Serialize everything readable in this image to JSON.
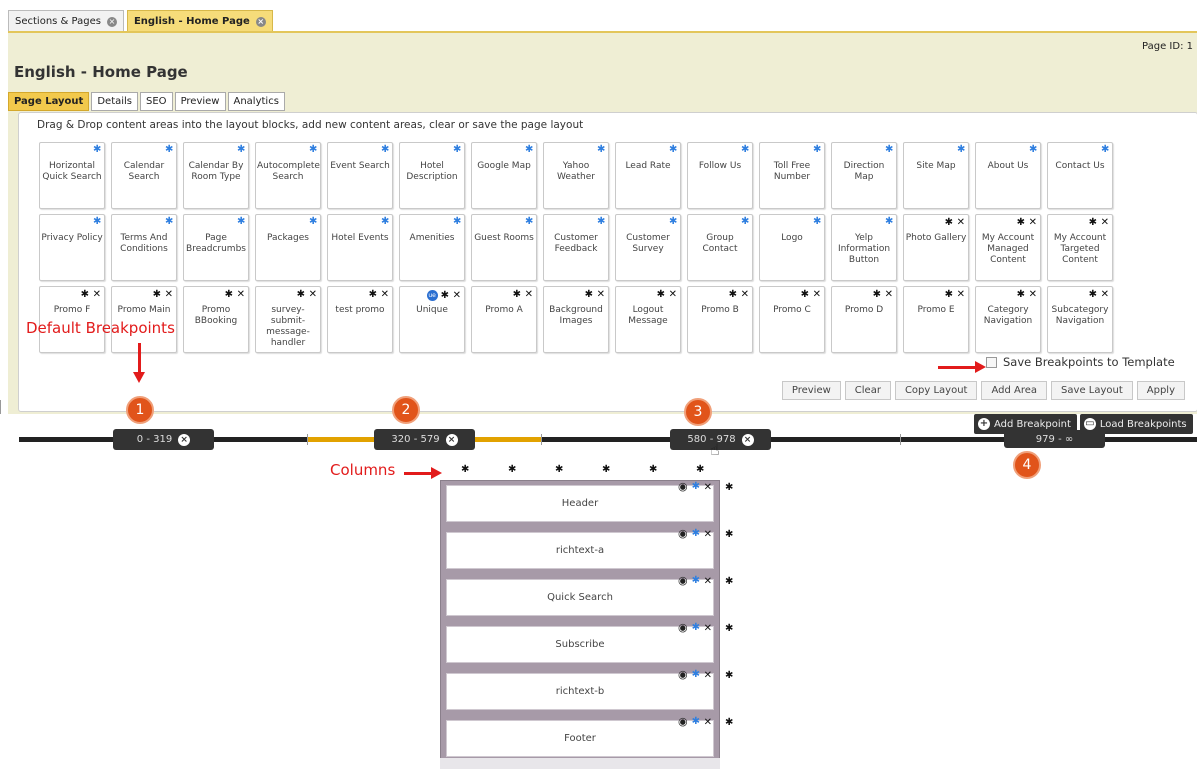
{
  "doc_tabs": [
    {
      "label": "Sections & Pages"
    },
    {
      "label": "English - Home Page"
    }
  ],
  "page_id_label": "Page ID: 1",
  "page_title": "English - Home Page",
  "sub_tabs": [
    "Page Layout",
    "Details",
    "SEO",
    "Preview",
    "Analytics"
  ],
  "instructions": "Drag & Drop content areas into the layout blocks, add new content areas, clear or save the page layout",
  "content_rows": [
    [
      {
        "label": "Horizontal Quick Search",
        "icons": "gear-blue"
      },
      {
        "label": "Calendar Search",
        "icons": "gear-blue"
      },
      {
        "label": "Calendar By Room Type",
        "icons": "gear-blue"
      },
      {
        "label": "Autocomplete Search",
        "icons": "gear-blue"
      },
      {
        "label": "Event Search",
        "icons": "gear-blue"
      },
      {
        "label": "Hotel Description",
        "icons": "gear-blue"
      },
      {
        "label": "Google Map",
        "icons": "gear-blue"
      },
      {
        "label": "Yahoo Weather",
        "icons": "gear-blue"
      },
      {
        "label": "Lead Rate",
        "icons": "gear-blue"
      },
      {
        "label": "Follow Us",
        "icons": "gear-blue"
      },
      {
        "label": "Toll Free Number",
        "icons": "gear-blue"
      },
      {
        "label": "Direction Map",
        "icons": "gear-blue"
      },
      {
        "label": "Site Map",
        "icons": "gear-blue"
      },
      {
        "label": "About Us",
        "icons": "gear-blue"
      },
      {
        "label": "Contact Us",
        "icons": "gear-blue"
      }
    ],
    [
      {
        "label": "Privacy Policy",
        "icons": "gear-blue"
      },
      {
        "label": "Terms And Conditions",
        "icons": "gear-blue"
      },
      {
        "label": "Page Breadcrumbs",
        "icons": "gear-blue"
      },
      {
        "label": "Packages",
        "icons": "gear-blue"
      },
      {
        "label": "Hotel Events",
        "icons": "gear-blue"
      },
      {
        "label": "Amenities",
        "icons": "gear-blue"
      },
      {
        "label": "Guest Rooms",
        "icons": "gear-blue"
      },
      {
        "label": "Customer Feedback",
        "icons": "gear-blue"
      },
      {
        "label": "Customer Survey",
        "icons": "gear-blue"
      },
      {
        "label": "Group Contact",
        "icons": "gear-blue"
      },
      {
        "label": "Logo",
        "icons": "gear-blue"
      },
      {
        "label": "Yelp Information Button",
        "icons": "gear-blue"
      },
      {
        "label": "Photo Gallery",
        "icons": "gear-x"
      },
      {
        "label": "My Account Managed Content",
        "icons": "gear-x"
      },
      {
        "label": "My Account Targeted Content",
        "icons": "gear-x"
      }
    ],
    [
      {
        "label": "Promo F",
        "icons": "gear-x"
      },
      {
        "label": "Promo Main",
        "icons": "gear-x"
      },
      {
        "label": "Promo BBooking",
        "icons": "gear-x"
      },
      {
        "label": "survey-submit-message-handler",
        "icons": "gear-x"
      },
      {
        "label": "test promo",
        "icons": "gear-x"
      },
      {
        "label": "Unique",
        "icons": "global-gear-x"
      },
      {
        "label": "Promo A",
        "icons": "gear-x"
      },
      {
        "label": "Background Images",
        "icons": "gear-x"
      },
      {
        "label": "Logout Message",
        "icons": "gear-x"
      },
      {
        "label": "Promo B",
        "icons": "gear-x"
      },
      {
        "label": "Promo C",
        "icons": "gear-x"
      },
      {
        "label": "Promo D",
        "icons": "gear-x"
      },
      {
        "label": "Promo E",
        "icons": "gear-x"
      },
      {
        "label": "Category Navigation",
        "icons": "gear-x"
      },
      {
        "label": "Subcategory Navigation",
        "icons": "gear-x"
      }
    ]
  ],
  "save_breakpoints_label": "Save Breakpoints to Template",
  "actions": [
    "Preview",
    "Clear",
    "Copy Layout",
    "Add Area",
    "Save Layout",
    "Apply"
  ],
  "breakpoints": [
    "0 - 319",
    "320 - 579",
    "580 - 978",
    "979 - ∞"
  ],
  "breakpoint_numbers": [
    "1",
    "2",
    "3",
    "4"
  ],
  "bp_tools": [
    "Add Breakpoint",
    "Load Breakpoints"
  ],
  "annotations": {
    "default_breakpoints": "Default Breakpoints",
    "columns": "Columns"
  },
  "layout_blocks": [
    "Header",
    "richtext-a",
    "Quick Search",
    "Subscribe",
    "richtext-b",
    "Footer"
  ],
  "colors": {
    "accent_yellow": "#f2c94c",
    "annotation_red": "#e21b1b",
    "badge_orange": "#e1541a",
    "gear_blue": "#2f7fe0"
  }
}
